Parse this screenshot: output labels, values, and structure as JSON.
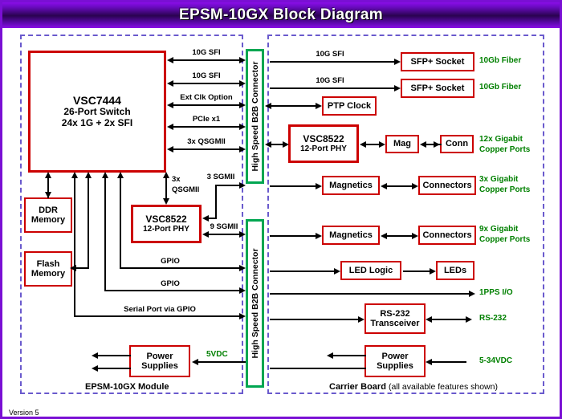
{
  "header": {
    "title": "EPSM-10GX Block Diagram"
  },
  "version": "Version 5",
  "colors": {
    "title_bar": "#6a0bc0",
    "box_border": "#cc0000",
    "connector": "#00a651",
    "green_label": "#008000",
    "region_border": "#6a5acd",
    "page_border": "#7a0fd4"
  },
  "regions": {
    "module": {
      "footer_bold": "EPSM-10GX Module",
      "footer_normal": ""
    },
    "carrier": {
      "footer_bold": "Carrier Board",
      "footer_normal": "(all available features shown)"
    }
  },
  "connectors": [
    {
      "label": "High Speed B2B Connector"
    },
    {
      "label": "High Speed B2B Connector"
    }
  ],
  "module_blocks": [
    {
      "name": "switch",
      "l1": "VSC7444",
      "l2": "26-Port Switch",
      "l3": "24x 1G + 2x SFI"
    },
    {
      "name": "ddr",
      "l1": "DDR",
      "l2": "Memory"
    },
    {
      "name": "flash",
      "l1": "Flash",
      "l2": "Memory"
    },
    {
      "name": "phy",
      "l1": "VSC8522",
      "l2": "12-Port PHY"
    },
    {
      "name": "power",
      "l1": "Power",
      "l2": "Supplies"
    }
  ],
  "carrier_blocks": [
    {
      "name": "sfp1",
      "l1": "SFP+ Socket"
    },
    {
      "name": "sfp2",
      "l1": "SFP+ Socket"
    },
    {
      "name": "ptp",
      "l1": "PTP Clock"
    },
    {
      "name": "phy",
      "l1": "VSC8522",
      "l2": "12-Port PHY"
    },
    {
      "name": "mag",
      "l1": "Mag"
    },
    {
      "name": "conn",
      "l1": "Conn"
    },
    {
      "name": "magnetics1",
      "l1": "Magnetics"
    },
    {
      "name": "connectors1",
      "l1": "Connectors"
    },
    {
      "name": "magnetics2",
      "l1": "Magnetics"
    },
    {
      "name": "connectors2",
      "l1": "Connectors"
    },
    {
      "name": "ledlogic",
      "l1": "LED Logic"
    },
    {
      "name": "leds",
      "l1": "LEDs"
    },
    {
      "name": "rs232",
      "l1": "RS-232",
      "l2": "Transceiver"
    },
    {
      "name": "power",
      "l1": "Power",
      "l2": "Supplies"
    }
  ],
  "signal_labels": {
    "switch_sfi1": "10G SFI",
    "switch_sfi2": "10G SFI",
    "ext_clk": "Ext Clk Option",
    "pcie": "PCIe x1",
    "qsgmii_3x": "3x QSGMII",
    "qsgmii_3x_down_a": "3x",
    "qsgmii_3x_down_b": "QSGMII",
    "sgmii_3": "3 SGMII",
    "sgmii_9": "9 SGMII",
    "gpio_1": "GPIO",
    "gpio_2": "GPIO",
    "serial": "Serial Port via GPIO",
    "vdc_5": "5VDC",
    "carrier_sfi1": "10G SFI",
    "carrier_sfi2": "10G SFI"
  },
  "green_labels": {
    "fiber1": "10Gb Fiber",
    "fiber2": "10Gb Fiber",
    "copper12_a": "12x Gigabit",
    "copper12_b": "Copper Ports",
    "copper3_a": "3x Gigabit",
    "copper3_b": "Copper Ports",
    "copper9_a": "9x Gigabit",
    "copper9_b": "Copper Ports",
    "pps": "1PPS I/O",
    "rs232": "RS-232",
    "vdc_range": "5-34VDC",
    "vdc_5": "5VDC"
  }
}
